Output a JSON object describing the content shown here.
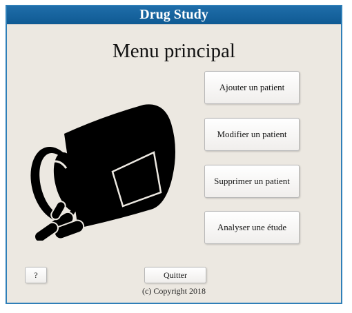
{
  "window": {
    "title": "Drug Study"
  },
  "main": {
    "heading": "Menu principal",
    "buttons": {
      "add_patient": "Ajouter un patient",
      "edit_patient": "Modifier un patient",
      "delete_patient": "Supprimer un patient",
      "analyze_study": "Analyser une étude"
    },
    "illustration_icon": "pill-bottle-icon"
  },
  "footer": {
    "help_label": "?",
    "quit_label": "Quitter",
    "copyright": "(c) Copyright 2018"
  },
  "colors": {
    "titlebar": "#1565a0",
    "background": "#ece8e1",
    "border": "#2f7fb8"
  }
}
